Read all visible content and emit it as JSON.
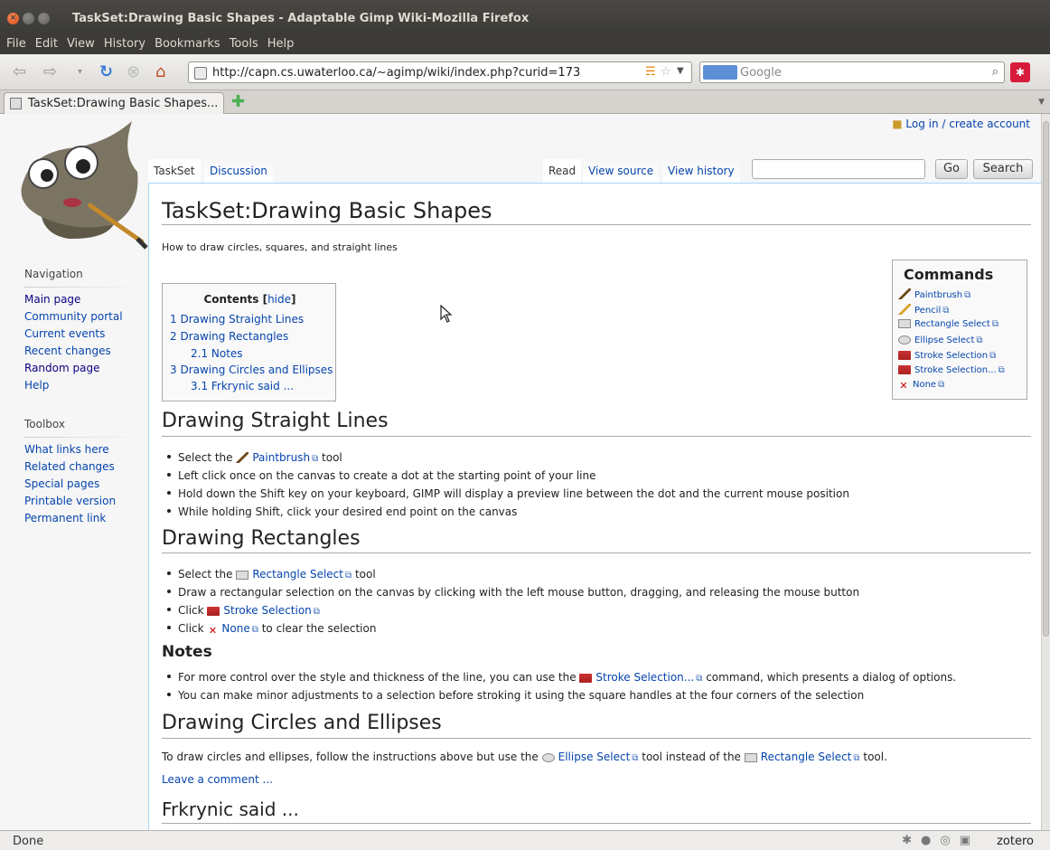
{
  "window": {
    "title": "TaskSet:Drawing Basic Shapes - Adaptable Gimp Wiki-Mozilla Firefox"
  },
  "menu": [
    "File",
    "Edit",
    "View",
    "History",
    "Bookmarks",
    "Tools",
    "Help"
  ],
  "address": {
    "url": "http://capn.cs.uwaterloo.ca/~agimp/wiki/index.php?curid=173"
  },
  "search": {
    "placeholder": "Google"
  },
  "tab": {
    "label": "TaskSet:Drawing Basic Shapes..."
  },
  "login": "Log in / create account",
  "sidebar": {
    "navigation_head": "Navigation",
    "navigation": [
      "Main page",
      "Community portal",
      "Current events",
      "Recent changes",
      "Random page",
      "Help"
    ],
    "toolbox_head": "Toolbox",
    "toolbox": [
      "What links here",
      "Related changes",
      "Special pages",
      "Printable version",
      "Permanent link"
    ]
  },
  "page_tabs": {
    "taskset": "TaskSet",
    "discussion": "Discussion",
    "read": "Read",
    "view_source": "View source",
    "view_history": "View history",
    "go": "Go",
    "search": "Search"
  },
  "article": {
    "title": "TaskSet:Drawing Basic Shapes",
    "subtitle": "How to draw circles, squares, and straight lines",
    "toc": {
      "title": "Contents",
      "hide": "hide",
      "items": [
        "1 Drawing Straight Lines",
        "2 Drawing Rectangles",
        "2.1 Notes",
        "3 Drawing Circles and Ellipses",
        "3.1 Frkrynic said ..."
      ]
    },
    "commands": {
      "title": "Commands",
      "items": [
        "Paintbrush",
        "Pencil",
        "Rectangle Select",
        "Ellipse Select",
        "Stroke Selection",
        "Stroke Selection...",
        "None"
      ]
    },
    "s1": {
      "title": "Drawing Straight Lines",
      "b1_pre": "Select the",
      "b1_link": "Paintbrush",
      "b1_post": "tool",
      "b2": "Left click once on the canvas to create a dot at the starting point of your line",
      "b3": "Hold down the Shift key on your keyboard, GIMP will display a preview line between the dot and the current mouse position",
      "b4": "While holding Shift, click your desired end point on the canvas"
    },
    "s2": {
      "title": "Drawing Rectangles",
      "b1_pre": "Select the",
      "b1_link": "Rectangle Select",
      "b1_post": "tool",
      "b2": "Draw a rectangular selection on the canvas by clicking with the left mouse button, dragging, and releasing the mouse button",
      "b3_pre": "Click",
      "b3_link": "Stroke Selection",
      "b4_pre": "Click",
      "b4_link": "None",
      "b4_post": "to clear the selection"
    },
    "notes": {
      "title": "Notes",
      "b1_pre": "For more control over the style and thickness of the line, you can use the",
      "b1_link": "Stroke Selection...",
      "b1_post": "command, which presents a dialog of options.",
      "b2": "You can make minor adjustments to a selection before stroking it using the square handles at the four corners of the selection"
    },
    "s3": {
      "title": "Drawing Circles and Ellipses",
      "p_pre": "To draw circles and ellipses, follow the instructions above but use the",
      "p_link1": "Ellipse Select",
      "p_mid": "tool instead of the",
      "p_link2": "Rectangle Select",
      "p_post": "tool.",
      "comment": "Leave a comment ..."
    },
    "s4": {
      "title": "Frkrynic said ..."
    }
  },
  "status": {
    "text": "Done",
    "zotero": "zotero"
  }
}
